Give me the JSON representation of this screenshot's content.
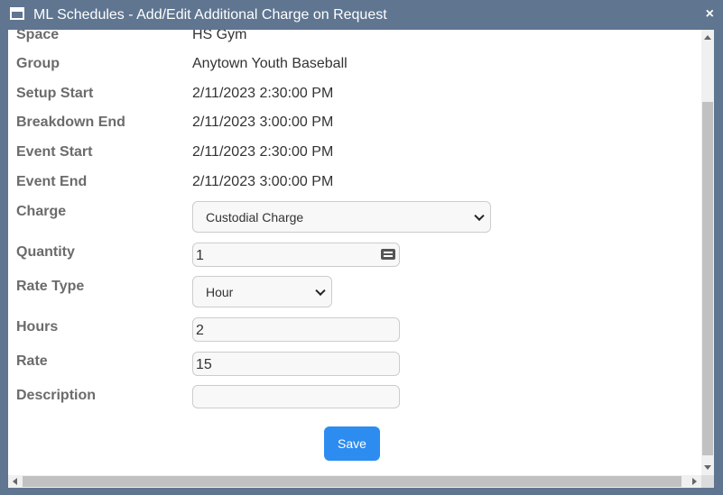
{
  "window": {
    "title": "ML Schedules - Add/Edit Additional Charge on Request",
    "close_symbol": "×"
  },
  "form": {
    "space": {
      "label": "Space",
      "value": "HS Gym"
    },
    "group": {
      "label": "Group",
      "value": "Anytown Youth Baseball"
    },
    "setup_start": {
      "label": "Setup Start",
      "value": "2/11/2023 2:30:00 PM"
    },
    "breakdown_end": {
      "label": "Breakdown End",
      "value": "2/11/2023 3:00:00 PM"
    },
    "event_start": {
      "label": "Event Start",
      "value": "2/11/2023 2:30:00 PM"
    },
    "event_end": {
      "label": "Event End",
      "value": "2/11/2023 3:00:00 PM"
    },
    "charge": {
      "label": "Charge",
      "selected": "Custodial Charge"
    },
    "quantity": {
      "label": "Quantity",
      "value": "1"
    },
    "rate_type": {
      "label": "Rate Type",
      "selected": "Hour"
    },
    "hours": {
      "label": "Hours",
      "value": "2"
    },
    "rate": {
      "label": "Rate",
      "value": "15"
    },
    "description": {
      "label": "Description",
      "value": ""
    }
  },
  "actions": {
    "save_label": "Save"
  },
  "icons": {
    "window": "window-icon",
    "close": "close-icon",
    "keyboard": "keyboard-icon",
    "chevron": "chevron-down-icon"
  },
  "colors": {
    "titlebar": "#5f7590",
    "save_button": "#2d8cf0"
  }
}
